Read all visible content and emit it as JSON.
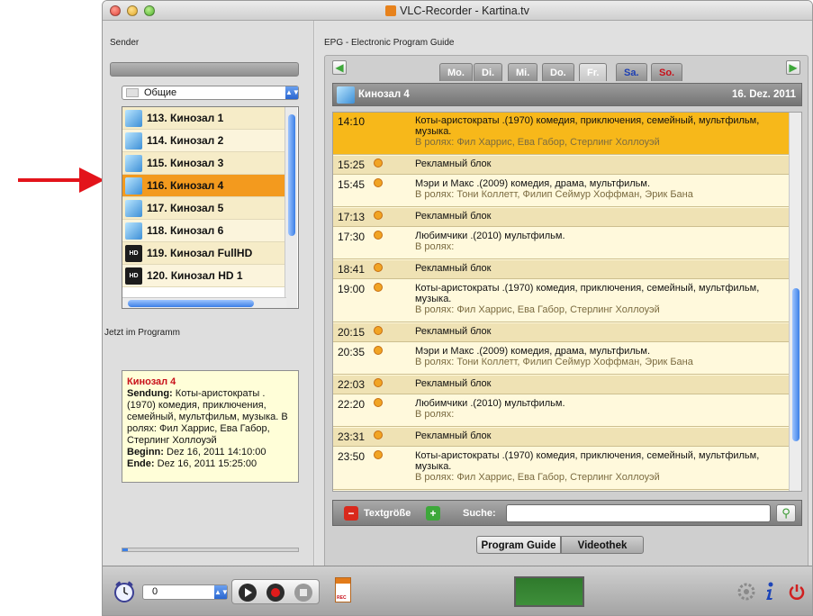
{
  "window": {
    "title": "VLC-Recorder - Kartina.tv",
    "buttons": [
      "close",
      "minimize",
      "maximize"
    ]
  },
  "sender": {
    "label": "Sender",
    "group_selected": "Общие",
    "channels": [
      {
        "label": "113. Кинозал 1",
        "icon": "tv-channel-icon",
        "selected": false
      },
      {
        "label": "114. Кинозал 2",
        "icon": "tv-channel-icon",
        "selected": false
      },
      {
        "label": "115. Кинозал 3",
        "icon": "tv-channel-icon",
        "selected": false
      },
      {
        "label": "116. Кинозал 4",
        "icon": "tv-channel-icon",
        "selected": true
      },
      {
        "label": "117. Кинозал 5",
        "icon": "tv-channel-icon",
        "selected": false
      },
      {
        "label": "118. Кинозал 6",
        "icon": "tv-channel-icon",
        "selected": false
      },
      {
        "label": "119. Кинозал FullHD",
        "icon": "hd-icon",
        "selected": false
      },
      {
        "label": "120. Кинозал HD 1",
        "icon": "hd-icon",
        "selected": false
      }
    ]
  },
  "jetzt": {
    "label": "Jetzt im Programm",
    "channel": "Кинозал 4",
    "sendung_label": "Sendung:",
    "sendung": "Коты-аристократы .(1970) комедия, приключения, семейный, мультфильм, музыка. В ролях: Фил Харрис, Ева Габор, Стерлинг Холлоуэй",
    "beginn_label": "Beginn:",
    "beginn": "Dez 16, 2011 14:10:00",
    "ende_label": "Ende:",
    "ende": "Dez 16, 2011 15:25:00",
    "progress": 0.03
  },
  "epg": {
    "label": "EPG - Electronic Program Guide",
    "days": [
      {
        "label": "Mo.",
        "active": false
      },
      {
        "label": "Di.",
        "active": false
      },
      {
        "label": "Mi.",
        "active": false
      },
      {
        "label": "Do.",
        "active": false
      },
      {
        "label": "Fr.",
        "active": true
      },
      {
        "label": "Sa.",
        "active": false
      },
      {
        "label": "So.",
        "active": false
      }
    ],
    "channel": "Кинозал 4",
    "date": "16. Dez. 2011",
    "programs": [
      {
        "time": "14:10",
        "title": "Коты-аристократы .(1970) комедия, приключения, семейный, мультфильм, музыка.",
        "cast": "В ролях: Фил Харрис, Ева Габор, Стерлинг Холлоуэй",
        "current": true,
        "clock": false
      },
      {
        "time": "15:25",
        "title": "Рекламный блок",
        "cast": "",
        "current": false,
        "clock": true
      },
      {
        "time": "15:45",
        "title": "Мэри и Макс .(2009) комедия, драма, мультфильм.",
        "cast": "В ролях: Тони Коллетт, Филип Сеймур Хоффман, Эрик Бана",
        "current": false,
        "clock": true
      },
      {
        "time": "17:13",
        "title": "Рекламный блок",
        "cast": "",
        "current": false,
        "clock": true
      },
      {
        "time": "17:30",
        "title": "Любимчики .(2010) мультфильм.",
        "cast": "В ролях:",
        "current": false,
        "clock": true
      },
      {
        "time": "18:41",
        "title": "Рекламный блок",
        "cast": "",
        "current": false,
        "clock": true
      },
      {
        "time": "19:00",
        "title": "Коты-аристократы .(1970) комедия, приключения, семейный, мультфильм, музыка.",
        "cast": "В ролях: Фил Харрис, Ева Габор, Стерлинг Холлоуэй",
        "current": false,
        "clock": true
      },
      {
        "time": "20:15",
        "title": "Рекламный блок",
        "cast": "",
        "current": false,
        "clock": true
      },
      {
        "time": "20:35",
        "title": "Мэри и Макс .(2009) комедия, драма, мультфильм.",
        "cast": "В ролях: Тони Коллетт, Филип Сеймур Хоффман, Эрик Бана",
        "current": false,
        "clock": true
      },
      {
        "time": "22:03",
        "title": "Рекламный блок",
        "cast": "",
        "current": false,
        "clock": true
      },
      {
        "time": "22:20",
        "title": "Любимчики .(2010) мультфильм.",
        "cast": "В ролях:",
        "current": false,
        "clock": true
      },
      {
        "time": "23:31",
        "title": "Рекламный блок",
        "cast": "",
        "current": false,
        "clock": true
      },
      {
        "time": "23:50",
        "title": "Коты-аристократы .(1970) комедия, приключения, семейный, мультфильм, музыка.",
        "cast": "В ролях: Фил Харрис, Ева Габор, Стерлинг Холлоуэй",
        "current": false,
        "clock": true
      }
    ],
    "textsize_label": "Textgröße",
    "search_label": "Suche:",
    "search_value": ""
  },
  "view_tabs": [
    {
      "label": "Program Guide",
      "active": true
    },
    {
      "label": "Videothek",
      "active": false
    }
  ],
  "toolbar": {
    "timer_value": "0",
    "icons": [
      "alarm-clock-icon",
      "play-icon",
      "record-icon",
      "stop-icon",
      "rec-file-icon",
      "gear-icon",
      "info-icon",
      "power-icon"
    ]
  },
  "colors": {
    "selected": "#f39a1e",
    "current_program": "#f7b81a",
    "channel_title": "#c8101a",
    "arrow": "#e3141b"
  }
}
